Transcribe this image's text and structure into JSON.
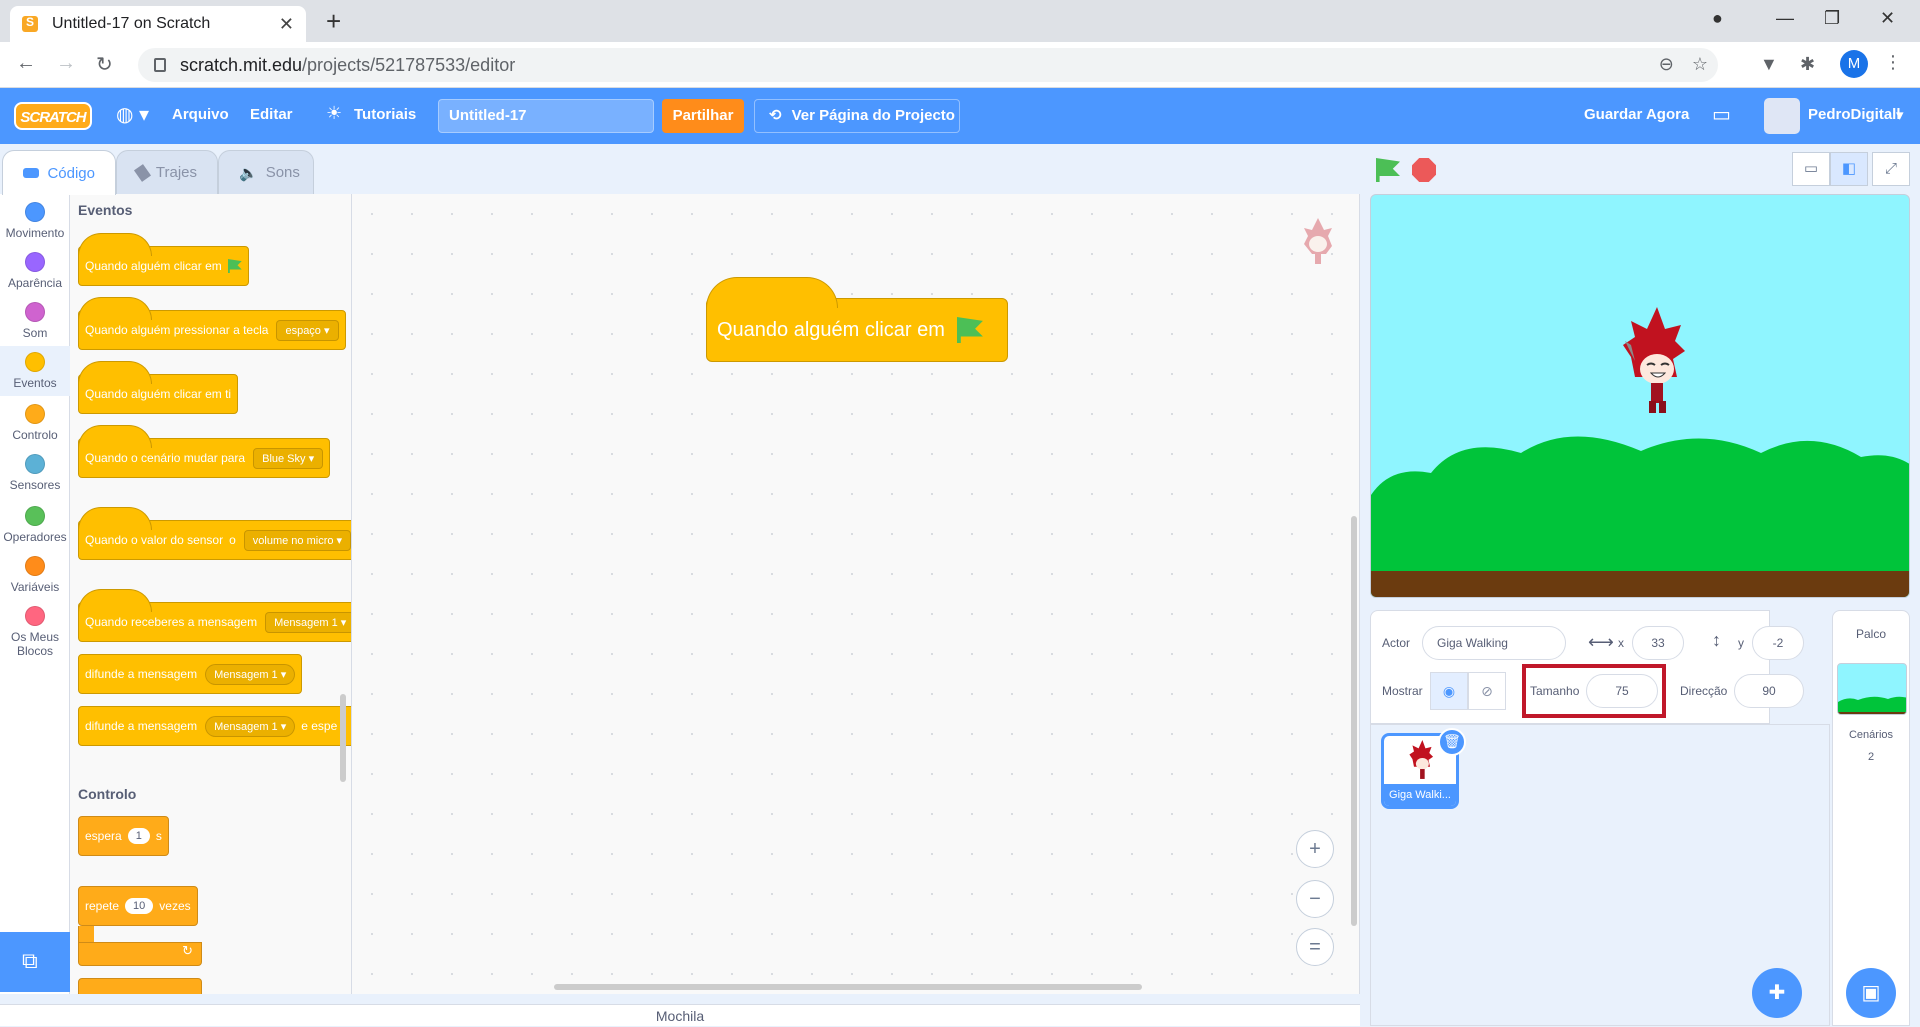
{
  "browser": {
    "tab_title": "Untitled-17 on Scratch",
    "url_host": "scratch.mit.edu",
    "url_path": "/projects/521787533/editor",
    "profile_initial": "M"
  },
  "menubar": {
    "logo": "SCRATCH",
    "file": "Arquivo",
    "edit": "Editar",
    "tutorials": "Tutoriais",
    "project_title": "Untitled-17",
    "share": "Partilhar",
    "see_project": "Ver Página do Projecto",
    "save_now": "Guardar Agora",
    "username": "PedroDigitall"
  },
  "tabs": {
    "code": "Código",
    "costumes": "Trajes",
    "sounds": "Sons"
  },
  "categories": [
    {
      "label": "Movimento",
      "color": "#4c97ff"
    },
    {
      "label": "Aparência",
      "color": "#9966ff"
    },
    {
      "label": "Som",
      "color": "#cf63cf"
    },
    {
      "label": "Eventos",
      "color": "#ffbf00"
    },
    {
      "label": "Controlo",
      "color": "#ffab19"
    },
    {
      "label": "Sensores",
      "color": "#5cb1d6"
    },
    {
      "label": "Operadores",
      "color": "#59c059"
    },
    {
      "label": "Variáveis",
      "color": "#ff8c1a"
    },
    {
      "label": "Os Meus Blocos",
      "color": "#ff6680"
    }
  ],
  "palette": {
    "events_title": "Eventos",
    "when_flag": "Quando alguém clicar em",
    "when_key": "Quando alguém pressionar a tecla",
    "key_option": "espaço",
    "when_clicked": "Quando alguém clicar em ti",
    "when_backdrop": "Quando o cenário mudar para",
    "backdrop_option": "Blue Sky",
    "when_sensor": "Quando o valor do sensor",
    "sensor_o": "o",
    "sensor_option": "volume no micro",
    "when_receive": "Quando receberes a mensagem",
    "message_option": "Mensagem 1",
    "broadcast": "difunde a mensagem",
    "broadcast_wait_suffix": "e espe",
    "control_title": "Controlo",
    "wait": "espera",
    "wait_value": "1",
    "wait_unit": "s",
    "repeat": "repete",
    "repeat_value": "10",
    "repeat_unit": "vezes"
  },
  "workspace": {
    "script_block": "Quando alguém clicar em",
    "zoom_in": "+",
    "zoom_out": "−",
    "zoom_reset": "="
  },
  "backpack": "Mochila",
  "sprite_info": {
    "actor_label": "Actor",
    "actor_name": "Giga Walking",
    "x_label": "x",
    "x_value": "33",
    "y_label": "y",
    "y_value": "-2",
    "show_label": "Mostrar",
    "size_label": "Tamanho",
    "size_value": "75",
    "direction_label": "Direcção",
    "direction_value": "90"
  },
  "sprite_list": [
    {
      "name": "Giga Walki..."
    }
  ],
  "stage_pane": {
    "title": "Palco",
    "backdrops_label": "Cenários",
    "backdrops_count": "2"
  }
}
